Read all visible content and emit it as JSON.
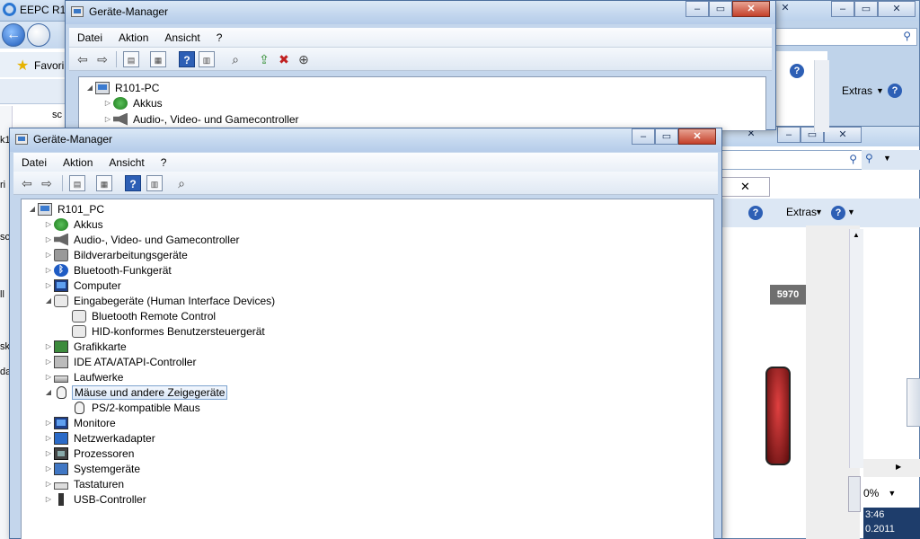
{
  "ie": {
    "title": "EEPC R1",
    "favorites": "Favori",
    "extras_label": "Extras",
    "badge": "5970",
    "zoom": "0%",
    "clock_time": "3:46",
    "clock_date": "0.2011",
    "left_fragments": [
      "sc",
      "k1",
      "ri",
      "sc",
      "ll",
      "sk",
      "da"
    ]
  },
  "dm_back": {
    "title": "Geräte-Manager",
    "menu": [
      "Datei",
      "Aktion",
      "Ansicht",
      "?"
    ],
    "tree": {
      "root": "R101-PC",
      "items": [
        "Akkus",
        "Audio-, Video- und Gamecontroller"
      ]
    }
  },
  "dm_front": {
    "title": "Geräte-Manager",
    "menu": [
      "Datei",
      "Aktion",
      "Ansicht",
      "?"
    ],
    "tree": {
      "root": "R101_PC",
      "items": [
        {
          "label": "Akkus",
          "icon": "battery-icon"
        },
        {
          "label": "Audio-, Video- und Gamecontroller",
          "icon": "speaker-icon"
        },
        {
          "label": "Bildverarbeitungsgeräte",
          "icon": "camera-icon"
        },
        {
          "label": "Bluetooth-Funkgerät",
          "icon": "bluetooth-icon"
        },
        {
          "label": "Computer",
          "icon": "monitor-icon"
        },
        {
          "label": "Eingabegeräte (Human Interface Devices)",
          "icon": "hid-icon",
          "expanded": true,
          "children": [
            "Bluetooth Remote Control",
            "HID-konformes Benutzersteuergerät"
          ]
        },
        {
          "label": "Grafikkarte",
          "icon": "graphics-card-icon"
        },
        {
          "label": "IDE ATA/ATAPI-Controller",
          "icon": "ide-controller-icon"
        },
        {
          "label": "Laufwerke",
          "icon": "drive-icon"
        },
        {
          "label": "Mäuse und andere Zeigegeräte",
          "icon": "mouse-icon",
          "expanded": true,
          "selected": true,
          "children": [
            "PS/2-kompatible Maus"
          ]
        },
        {
          "label": "Monitore",
          "icon": "monitor-icon"
        },
        {
          "label": "Netzwerkadapter",
          "icon": "network-adapter-icon"
        },
        {
          "label": "Prozessoren",
          "icon": "cpu-icon"
        },
        {
          "label": "Systemgeräte",
          "icon": "system-devices-icon"
        },
        {
          "label": "Tastaturen",
          "icon": "keyboard-icon"
        },
        {
          "label": "USB-Controller",
          "icon": "usb-icon"
        }
      ]
    }
  }
}
